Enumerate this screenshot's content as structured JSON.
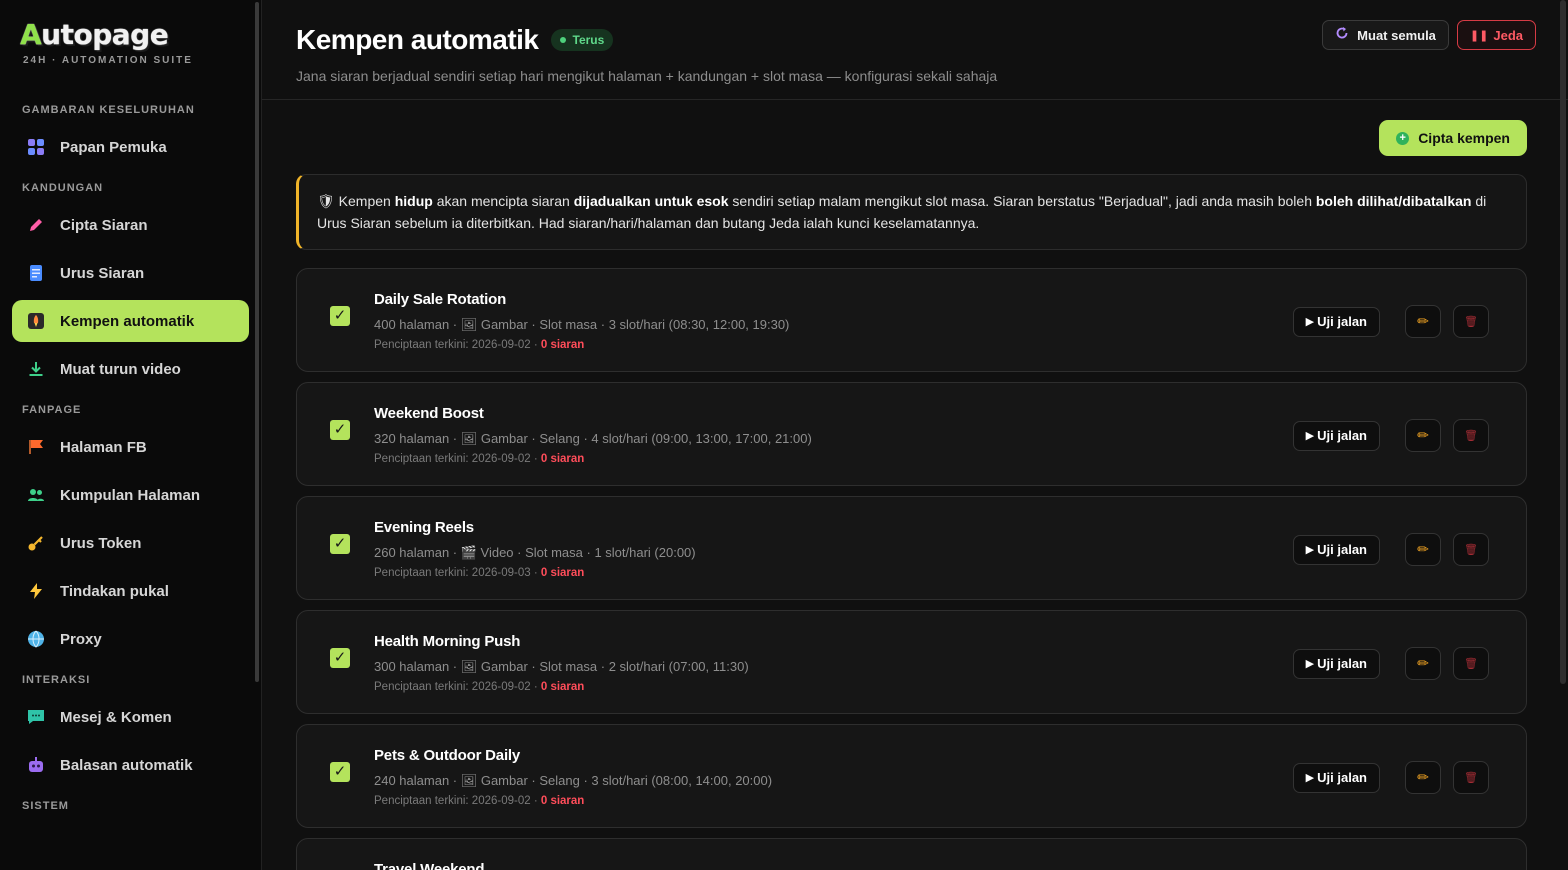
{
  "brand": {
    "name_first": "A",
    "name_rest": "utopage",
    "tagline": "24H · AUTOMATION SUITE"
  },
  "sidebar": {
    "sections": {
      "overview": "GAMBARAN KESELURUHAN",
      "content": "KANDUNGAN",
      "fanpage": "FANPAGE",
      "interaction": "INTERAKSI",
      "system": "SISTEM"
    },
    "items": {
      "dashboard": "Papan Pemuka",
      "create_post": "Cipta Siaran",
      "manage_posts": "Urus Siaran",
      "auto_campaign": "Kempen automatik",
      "download_video": "Muat turun video",
      "fb_pages": "Halaman FB",
      "page_groups": "Kumpulan Halaman",
      "manage_token": "Urus Token",
      "bulk_actions": "Tindakan pukal",
      "proxy": "Proxy",
      "messages": "Mesej & Komen",
      "auto_reply": "Balasan automatik"
    }
  },
  "header": {
    "title": "Kempen automatik",
    "status": "Terus",
    "subtitle": "Jana siaran berjadual sendiri setiap hari mengikut halaman + kandungan + slot masa — konfigurasi sekali sahaja",
    "reload_label": "Muat semula",
    "pause_label": "Jeda"
  },
  "create_label": "Cipta kempen",
  "notice": {
    "icon": "🛡",
    "p1": " Kempen ",
    "b1": "hidup",
    "p2": " akan mencipta siaran ",
    "b2": "dijadualkan untuk esok",
    "p3": " sendiri setiap malam mengikut slot masa. Siaran berstatus \"Berjadual\", jadi anda masih boleh ",
    "b3": "boleh dilihat/dibatalkan",
    "p4": " di Urus Siaran sebelum ia diterbitkan. Had siaran/hari/halaman dan butang Jeda ialah kunci keselamatannya."
  },
  "test_label": "Uji jalan",
  "campaigns": [
    {
      "name": "Daily Sale Rotation",
      "meta": "400 halaman · 🖼 Gambar · Slot masa · 3 slot/hari (08:30, 12:00, 19:30)",
      "latest": "Penciptaan terkini: 2026-09-02 · ",
      "posts": "0 siaran"
    },
    {
      "name": "Weekend Boost",
      "meta": "320 halaman · 🖼 Gambar · Selang · 4 slot/hari (09:00, 13:00, 17:00, 21:00)",
      "latest": "Penciptaan terkini: 2026-09-02 · ",
      "posts": "0 siaran"
    },
    {
      "name": "Evening Reels",
      "meta": "260 halaman · 🎬 Video · Slot masa · 1 slot/hari (20:00)",
      "latest": "Penciptaan terkini: 2026-09-03 · ",
      "posts": "0 siaran"
    },
    {
      "name": "Health Morning Push",
      "meta": "300 halaman · 🖼 Gambar · Slot masa · 2 slot/hari (07:00, 11:30)",
      "latest": "Penciptaan terkini: 2026-09-02 · ",
      "posts": "0 siaran"
    },
    {
      "name": "Pets & Outdoor Daily",
      "meta": "240 halaman · 🖼 Gambar · Selang · 3 slot/hari (08:00, 14:00, 20:00)",
      "latest": "Penciptaan terkini: 2026-09-02 · ",
      "posts": "0 siaran"
    },
    {
      "name": "Travel Weekend"
    }
  ],
  "colors": {
    "accent": "#b4e35c",
    "danger": "#ff4d5a",
    "status_green": "#5fd88a",
    "notice_border": "#f0b429"
  }
}
